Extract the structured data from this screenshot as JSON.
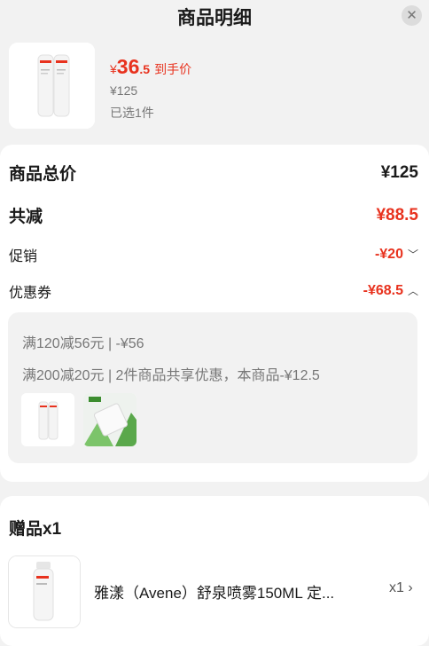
{
  "header": {
    "title": "商品明细",
    "close_icon": "close-icon"
  },
  "product": {
    "currency": "¥",
    "price_int": "36",
    "price_dec": ".5",
    "price_tag": "到手价",
    "original_price": "¥125",
    "selected": "已选1件",
    "brand": "Avène"
  },
  "summary": {
    "total_label": "商品总价",
    "total_value": "¥125",
    "discount_label": "共减",
    "discount_value": "¥88.5",
    "promo_label": "促销",
    "promo_value": "-¥20",
    "coupon_label": "优惠券",
    "coupon_value": "-¥68.5"
  },
  "coupons": {
    "line1": "满120减56元 | -¥56",
    "line2": "满200减20元 | 2件商品共享优惠，本商品-¥12.5"
  },
  "gift": {
    "title": "赠品x1",
    "name": "雅漾（Avene）舒泉喷雾150ML 定...",
    "qty": "x1"
  },
  "colors": {
    "accent": "#e8321e",
    "background": "#f2f2f2"
  }
}
